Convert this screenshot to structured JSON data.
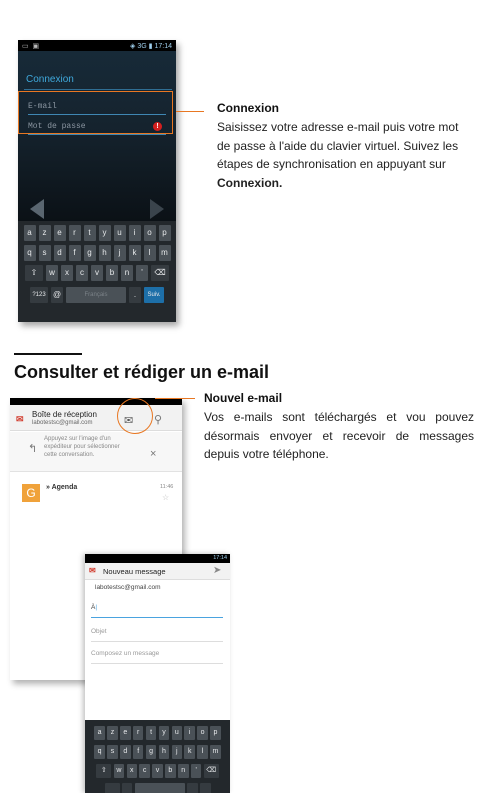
{
  "phone1": {
    "status_time": "17:14",
    "status_network": "3G",
    "title": "Connexion",
    "email_placeholder": "E-mail",
    "password_placeholder": "Mot de passe",
    "alert_icon": "!",
    "keyboard": {
      "row1": [
        "a",
        "z",
        "e",
        "r",
        "t",
        "y",
        "u",
        "i",
        "o",
        "p"
      ],
      "row2": [
        "q",
        "s",
        "d",
        "f",
        "g",
        "h",
        "j",
        "k",
        "l",
        "m"
      ],
      "row3": [
        "w",
        "x",
        "c",
        "v",
        "b",
        "n",
        "'"
      ],
      "shift_key": "⇧",
      "delete_key": "⌫",
      "numbers_key": "?123",
      "at_key": "@",
      "space_label": "Français",
      "period_key": ".",
      "next_key": "Suiv."
    }
  },
  "callout1": {
    "title": "Connexion",
    "text_before": "Saisissez votre adresse e-mail puis votre mot de passe à l'aide du clavier virtuel. Suivez les étapes de synchronisation en appuyant sur ",
    "text_bold": "Connexion.",
    "accent_color": "#e87722"
  },
  "section": {
    "title": "Consulter et rédiger un e-mail"
  },
  "phone2": {
    "title": "Boîte de réception",
    "account": "labotestsc@gmail.com",
    "tip_text": "Appuyez sur l'image d'un expéditeur pour sélectionner cette conversation.",
    "close_glyph": "×",
    "avatar_letter": "G",
    "row_label": "» Agenda",
    "row_time": "11:46",
    "star_glyph": "☆"
  },
  "callout2": {
    "title": "Nouvel e-mail",
    "text": "Vos e-mails sont téléchargés et vou pouvez désormais envoyer et recevoir de messages depuis votre téléphone."
  },
  "phone3": {
    "status_time": "17:14",
    "title": "Nouveau message",
    "from": "labotestsc@gmail.com",
    "to_placeholder": "À",
    "subject_placeholder": "Objet",
    "body_placeholder": "Composez un message",
    "keyboard": {
      "row1": [
        "a",
        "z",
        "e",
        "r",
        "t",
        "y",
        "u",
        "i",
        "o",
        "p"
      ],
      "row2": [
        "q",
        "s",
        "d",
        "f",
        "g",
        "h",
        "j",
        "k",
        "l",
        "m"
      ],
      "row3": [
        "w",
        "x",
        "c",
        "v",
        "b",
        "n",
        "'"
      ],
      "shift_key": "⇧",
      "delete_key": "⌫"
    }
  }
}
